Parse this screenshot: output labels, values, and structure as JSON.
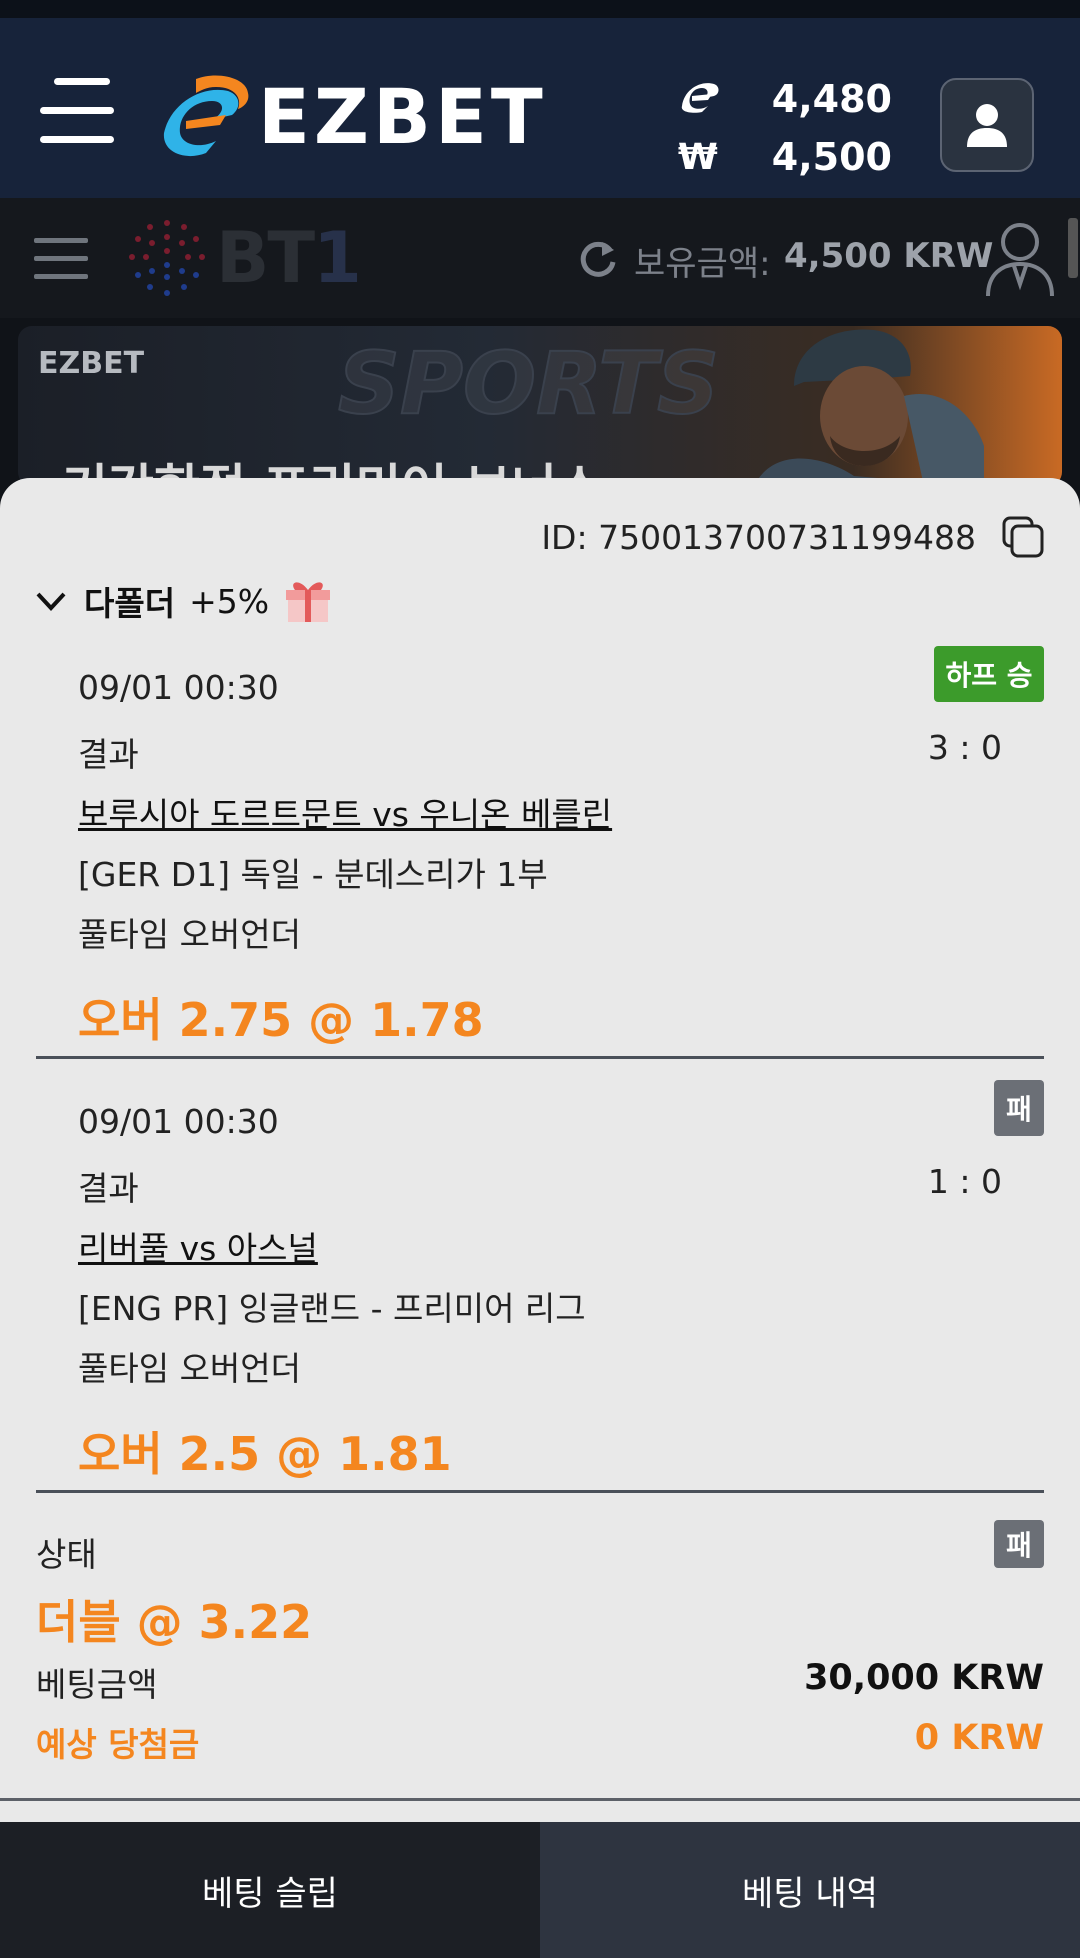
{
  "header": {
    "brand": "EZBET",
    "balance_points": "4,480",
    "balance_won_symbol": "₩",
    "balance_won": "4,500"
  },
  "subheader": {
    "logo_text": "BT",
    "logo_text_accent": "1",
    "hold_label": "보유금액:",
    "hold_value": "4,500 KRW"
  },
  "banner": {
    "logo": "EZBET",
    "watermark": "SPORTS",
    "headline": "기간한정 프리미어 보너스"
  },
  "slip": {
    "id_text": "ID: 750013700731199488",
    "multi_title": "다폴더",
    "multi_bonus": "+5%",
    "bets": [
      {
        "datetime": "09/01 00:30",
        "market": "결과",
        "score": "3 : 0",
        "match": "보루시아 도르트문트 vs 우니온 베를린",
        "league": "[GER D1] 독일 - 분데스리가 1부",
        "bet_type": "풀타임 오버언더",
        "pick": "오버 2.75 @ 1.78",
        "status": "하프 승",
        "status_color": "#3c9b2b"
      },
      {
        "datetime": "09/01 00:30",
        "market": "결과",
        "score": "1 : 0",
        "match": "리버풀 vs 아스널",
        "league": "[ENG PR] 잉글랜드 - 프리미어 리그",
        "bet_type": "풀타임 오버언더",
        "pick": "오버 2.5 @ 1.81",
        "status": "패",
        "status_color": "#6b6f76"
      }
    ],
    "summary": {
      "status_label": "상태",
      "status": "패",
      "total": "더블 @ 3.22",
      "stake_label": "베팅금액",
      "stake_value": "30,000 KRW",
      "payout_label": "예상 당첨금",
      "payout_value": "0 KRW"
    }
  },
  "tabs": {
    "slip": "베팅 슬립",
    "history": "베팅 내역"
  },
  "colors": {
    "accent_orange": "#f4861f",
    "header_bg": "#17233a",
    "win_green": "#3c9b2b",
    "lose_gray": "#6b6f76"
  },
  "icons": [
    "hamburger-menu-icon",
    "ezbet-logo-icon",
    "points-icon",
    "won-icon",
    "user-icon",
    "menu-icon",
    "refresh-icon",
    "user-outline-icon",
    "copy-icon",
    "chevron-down-icon",
    "gift-icon"
  ]
}
